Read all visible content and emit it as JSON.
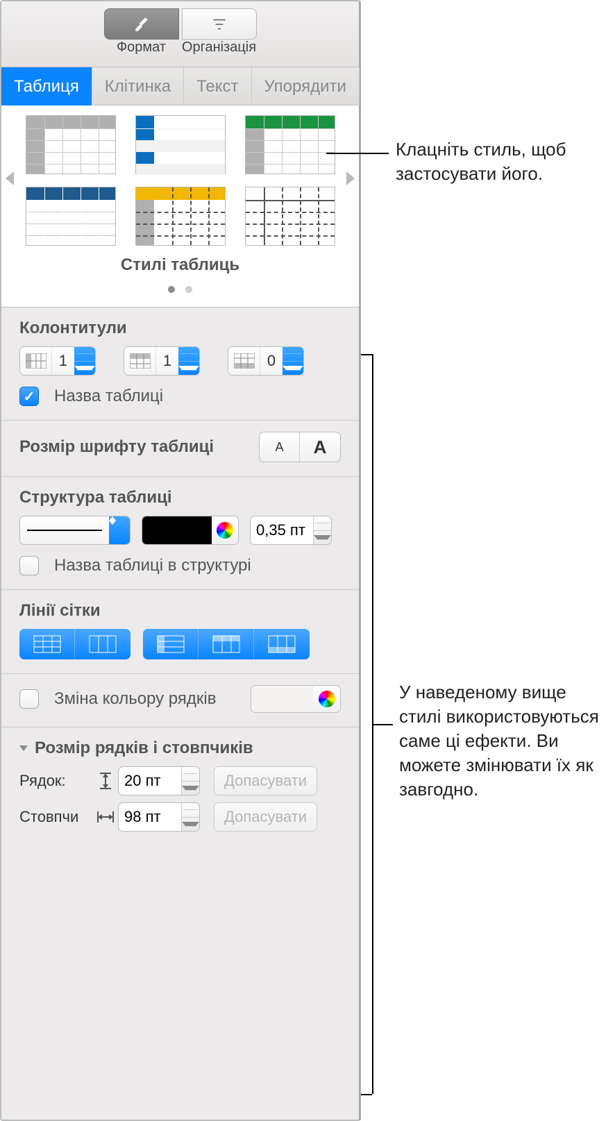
{
  "toolbar": {
    "format_label": "Формат",
    "organize_label": "Організація"
  },
  "tabs": {
    "table": "Таблиця",
    "cell": "Клітинка",
    "text": "Текст",
    "arrange": "Упорядити"
  },
  "styles": {
    "caption": "Стилі таблиць"
  },
  "headers": {
    "title": "Колонтитули",
    "col_value": "1",
    "row_value": "1",
    "footer_value": "0",
    "table_name_label": "Назва таблиці",
    "table_name_checked": true
  },
  "font_size": {
    "title": "Розмір шрифту таблиці",
    "small": "A",
    "large": "A"
  },
  "outline": {
    "title": "Структура таблиці",
    "width_value": "0,35 пт",
    "in_outline_label": "Назва таблиці в структурі",
    "in_outline_checked": false
  },
  "gridlines": {
    "title": "Лінії сітки"
  },
  "row_color": {
    "label": "Зміна кольору рядків",
    "checked": false
  },
  "row_col_size": {
    "title": "Розмір рядків і стовпчиків",
    "row_label": "Рядок:",
    "row_value": "20 пт",
    "col_label": "Стовпчи",
    "col_value": "98 пт",
    "fit_label": "Допасувати"
  },
  "callouts": {
    "top": "Клацніть стиль, щоб застосувати його.",
    "bottom": "У наведеному вище стилі використовуються саме ці ефекти. Ви можете змінювати їх як завгодно."
  }
}
